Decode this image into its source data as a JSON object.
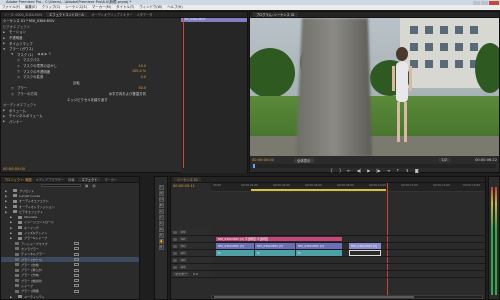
{
  "window": {
    "title": "Adobe Premiere Pro - C:\\Users\\...\\Adobe\\Premiere Pro\\6.0\\無題.prproj *"
  },
  "menu": [
    "ファイル(F)",
    "編集(E)",
    "クリップ(C)",
    "シーケンス(S)",
    "マーカー(M)",
    "タイトル(T)",
    "ウィンドウ(W)",
    "ヘルプ(H)"
  ],
  "effect_controls": {
    "tabs": [
      "ソース: 0000_ZUEA.MOV",
      "エフェクトコントロール",
      "オーディオクリップミキサー",
      "メタデータ"
    ],
    "header": "シーケンス 01 * MVI_0364.MOV",
    "clip_label": "MVI_0364.MOV",
    "section_title": "ビデオエフェクト",
    "rows": [
      {
        "name": "モーション",
        "value": ""
      },
      {
        "name": "不透明度",
        "value": ""
      },
      {
        "name": "タイムリマップ",
        "value": ""
      },
      {
        "name": "ブラー (ガウス)",
        "value": ""
      },
      {
        "name": "マスク (1)",
        "value": ""
      },
      {
        "name": "マスクパス",
        "value": ""
      },
      {
        "name": "マスクの境界のぼかし",
        "value": "10.0"
      },
      {
        "name": "マスクの不透明度",
        "value": "100.0 %"
      },
      {
        "name": "マスクの拡張",
        "value": "0.0"
      },
      {
        "name": "",
        "value": "反転"
      },
      {
        "name": "ブラー",
        "value": "50.0"
      },
      {
        "name": "ブラーの方向",
        "value": "水平方向および垂直方向"
      },
      {
        "name": "",
        "value": "エッジピクセルを繰り返す"
      },
      {
        "name": "オーディオエフェクト",
        "value": ""
      },
      {
        "name": "ボリューム",
        "value": ""
      },
      {
        "name": "チャンネルボリューム",
        "value": ""
      },
      {
        "name": "パンナー",
        "value": ""
      }
    ],
    "timecode": "00:00:00:00"
  },
  "program_monitor": {
    "tab": "プログラム: シーケンス 01",
    "timecode_current": "00:00:00:00",
    "timecode_duration": "00:00:06:22",
    "fit_label": "全体表示",
    "quality_label": "1/2"
  },
  "project": {
    "tabs": [
      "プロジェクト: 無題",
      "メディアブラウザー",
      "情報",
      "エフェクト",
      "マーカー",
      "ヒストリー"
    ],
    "search_placeholder": "",
    "items": [
      {
        "name": "プリセット",
        "type": "folder",
        "indent": 0
      },
      {
        "name": "Lumetri Looks",
        "type": "folder",
        "indent": 0
      },
      {
        "name": "オーディオエフェクト",
        "type": "folder",
        "indent": 0
      },
      {
        "name": "オーディオトランジション",
        "type": "folder",
        "indent": 0
      },
      {
        "name": "ビデオエフェクト",
        "type": "folder",
        "indent": 0
      },
      {
        "name": "Obsolete",
        "type": "folder",
        "indent": 1
      },
      {
        "name": "イメージコントロール",
        "type": "folder",
        "indent": 1
      },
      {
        "name": "キーイング",
        "type": "folder",
        "indent": 1
      },
      {
        "name": "ノイズ&グレイン",
        "type": "folder",
        "indent": 1
      },
      {
        "name": "ブラー&シャープ",
        "type": "folder",
        "indent": 1
      },
      {
        "name": "アンシャープマスク",
        "type": "item",
        "indent": 2
      },
      {
        "name": "カメラブラー",
        "type": "item",
        "indent": 2
      },
      {
        "name": "チャンネルブラー",
        "type": "item",
        "indent": 2
      },
      {
        "name": "ブラー (ガウス)",
        "type": "item",
        "indent": 2,
        "selected": true
      },
      {
        "name": "ブラー (合成)",
        "type": "item",
        "indent": 2
      },
      {
        "name": "ブラー (滑らか)",
        "type": "item",
        "indent": 2
      },
      {
        "name": "ブラー (方向)",
        "type": "item",
        "indent": 2
      },
      {
        "name": "ブラー (放射状)",
        "type": "item",
        "indent": 2
      },
      {
        "name": "シャープ",
        "type": "item",
        "indent": 2
      },
      {
        "name": "ブラー (詳細)",
        "type": "item",
        "indent": 2
      },
      {
        "name": "ユーティリティ",
        "type": "folder",
        "indent": 1
      }
    ]
  },
  "timeline": {
    "tab": "シーケンス 01",
    "timecode": "00:00:05:11",
    "ruler_labels": [
      "00:00",
      "00:00:02:00",
      "00:00:04:00",
      "00:00:06:00",
      "00:00:08:00",
      "00:00:10:00",
      "00:00:12:00",
      "00:00:14:00",
      "00:00:16:00"
    ],
    "tracks": [
      "V3",
      "V2",
      "V1",
      "A1",
      "A2",
      "A3",
      "マスター"
    ],
    "clips": {
      "pink": "MVI_0364.MOV [V] 不透明度:不透明度",
      "v1_a": "MVI_0364.MOV [V]",
      "v1_b": "MVI_0364.MOV [V]",
      "v1_c": "MVI_0364.MOV [V]",
      "v1_d": "MVI_0364.MOV [V]",
      "a1_a": "fx",
      "a1_b": "fx",
      "a1_c": "fx"
    },
    "master_value": "0.0"
  },
  "colors": {
    "accent": "#e0a046",
    "clip_video": "#6b6fb8",
    "clip_audio": "#4fa0a6",
    "clip_pink": "#c4467a",
    "playhead": "#d04040"
  }
}
